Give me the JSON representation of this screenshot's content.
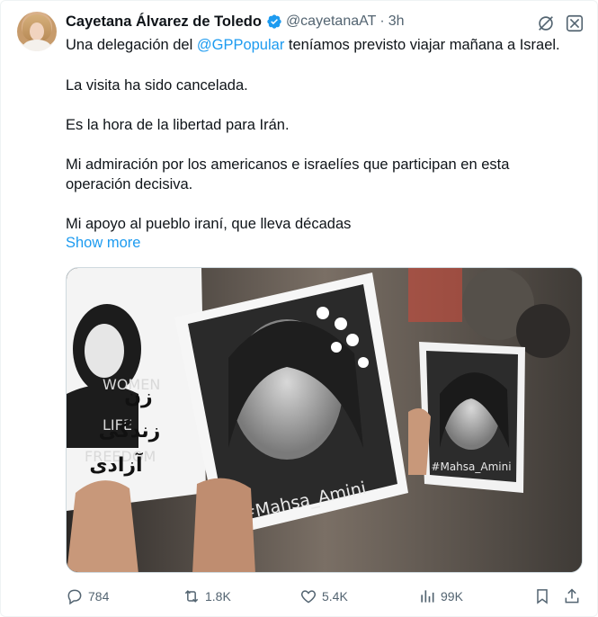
{
  "author": {
    "name": "Cayetana Álvarez de Toledo",
    "handle": "@cayetanaAT",
    "separator": "·",
    "time": "3h"
  },
  "text": {
    "line1_a": "Una delegación del ",
    "line1_mention": "@GPPopular",
    "line1_b": " teníamos previsto viajar mañana a Israel.",
    "line2": "La visita ha sido cancelada.",
    "line3": "Es la hora de la libertad para Irán.",
    "line4a": "Mi admiración por los americanos e israelíes que participan en esta",
    "line4b": "operación decisiva.",
    "line5": "Mi apoyo al pueblo iraní, que lleva décadas",
    "show_more": "Show more"
  },
  "media": {
    "sign_left_text": [
      "زن",
      "زندگی",
      "آزادی"
    ],
    "sign_left_bg_text": [
      "WOMEN",
      "LIFE",
      "FREEDOM"
    ],
    "sign_center_caption": "#Mahsa_Amini",
    "sign_right_caption": "#Mahsa_Amini"
  },
  "actions": {
    "replies": "784",
    "reposts": "1.8K",
    "likes": "5.4K",
    "views": "99K"
  },
  "colors": {
    "accent": "#1d9bf0",
    "secondary_text": "#536471",
    "primary_text": "#0f1419"
  },
  "icons": [
    "verified-badge-icon",
    "grok-icon",
    "more-icon",
    "reply-icon",
    "repost-icon",
    "like-icon",
    "views-icon",
    "bookmark-icon",
    "share-icon"
  ]
}
